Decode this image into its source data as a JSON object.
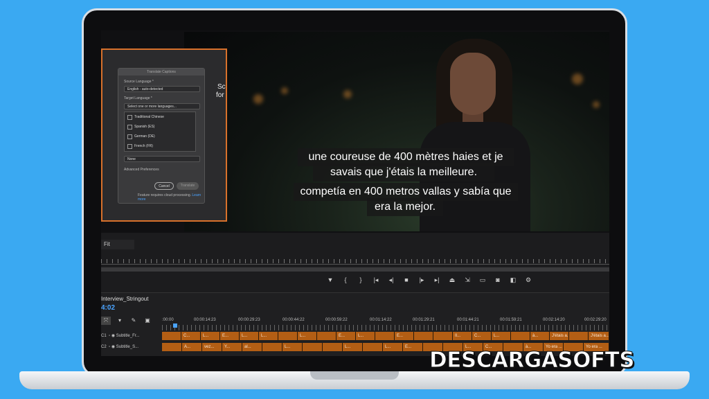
{
  "dialog": {
    "title": "Translate Captions",
    "source_label": "Source Language *",
    "source_value": "English - auto-detected",
    "target_label": "Target Language *",
    "target_placeholder": "Select one or more languages...",
    "options": [
      "Traditional Chinese",
      "Spanish (ES)",
      "German (DE)",
      "French (FR)"
    ],
    "track_value": "None",
    "advanced": "Advanced Preferences",
    "cancel": "Cancel",
    "translate": "Translate",
    "footer": "Feature requires cloud processing.",
    "learn_more": "Learn more"
  },
  "side_text": [
    "Sc",
    "for"
  ],
  "subtitles": {
    "fr_line1": "une coureuse de 400 mètres haies et je",
    "fr_line2": "savais que j'étais la meilleure.",
    "es_line1": "competía en 400 metros vallas y sabía que",
    "es_line2": "era la mejor."
  },
  "zoom": "Fit",
  "transport_icons": [
    "marker-icon",
    "in-point-icon",
    "out-point-icon",
    "go-to-in-icon",
    "step-back-icon",
    "stop-icon",
    "step-forward-icon",
    "go-to-out-icon",
    "lift-icon",
    "extract-icon",
    "safe-margins-icon",
    "camera-icon",
    "compare-icon",
    "settings-icon"
  ],
  "timeline": {
    "sequence": "Interview_Stringout",
    "timecode": "4:02",
    "timecodes": [
      ":00:00",
      "00:00:14:23",
      "00:00:29:23",
      "00:00:44:22",
      "00:00:59:22",
      "00:01:14:22",
      "00:01:29:21",
      "00:01:44:21",
      "00:01:59:21",
      "00:02:14:20",
      "00:02:29:20"
    ],
    "tracks": [
      {
        "id": "C1",
        "name": "Subtitle_Fr...",
        "clips": [
          "",
          "C...",
          "L...",
          "E...",
          "L...",
          "L...",
          "",
          "L...",
          "",
          "E...",
          "L...",
          "",
          "E...",
          "",
          "",
          "Il...",
          "C...",
          "L...",
          "",
          "à...",
          "J'étais a...",
          "",
          "J'étais a..."
        ]
      },
      {
        "id": "C2",
        "name": "Subtitle_S...",
        "clips": [
          "",
          "A...",
          "vez...",
          "Y...",
          "al...",
          "",
          "L...",
          "",
          "",
          "L...",
          "",
          "L...",
          "E...",
          "",
          "",
          "L...",
          "C...",
          "",
          "à...",
          "Yo era ...",
          "",
          "Yo era ..."
        ]
      }
    ]
  },
  "watermark": "DESCARGASOFTS",
  "colors": {
    "background": "#3aa9f2",
    "accent": "#d9712b",
    "clip": "#b35e14",
    "timecode": "#4aa3ff"
  }
}
